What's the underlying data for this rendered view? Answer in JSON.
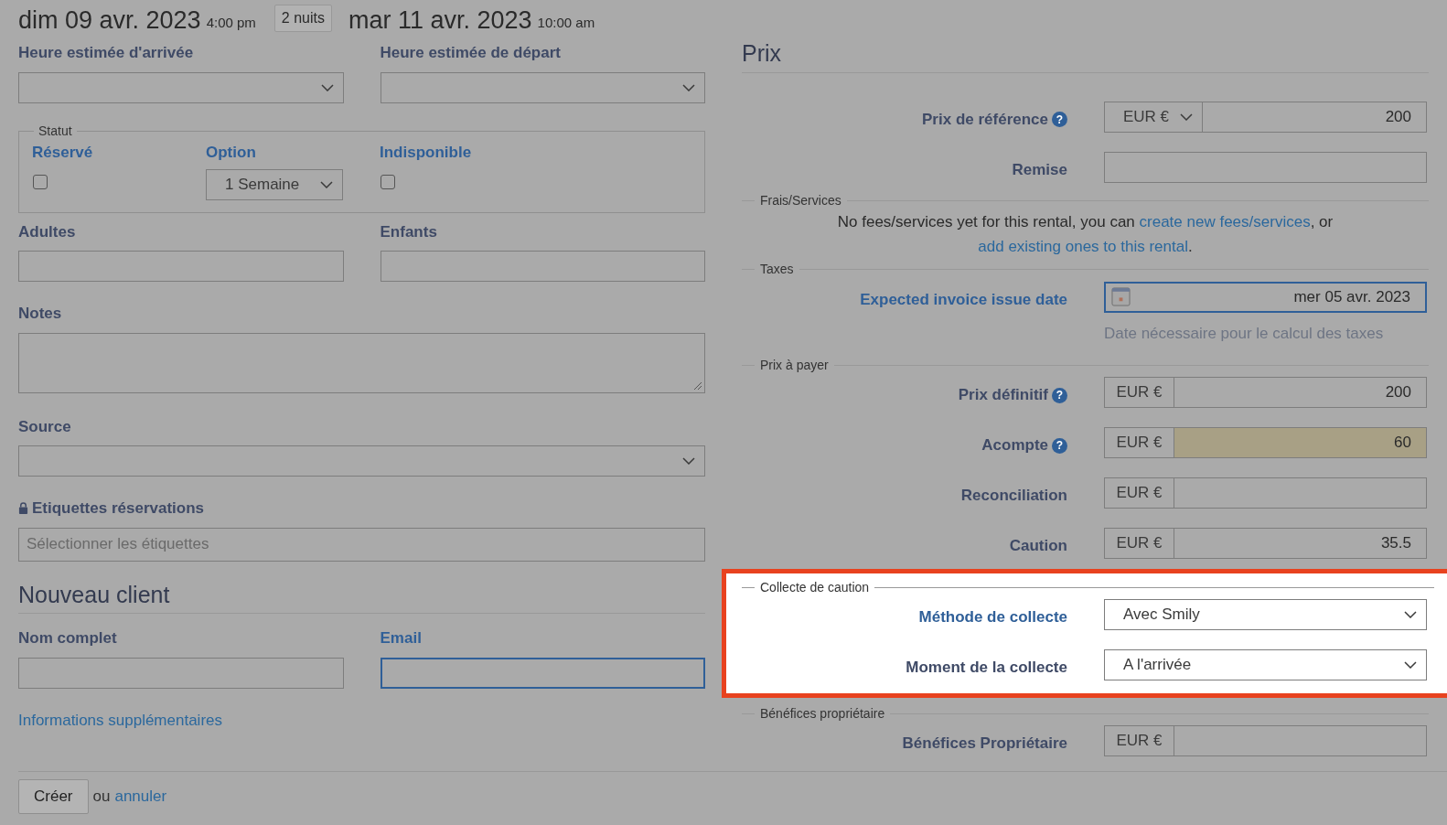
{
  "header": {
    "arrival_date": "dim 09 avr. 2023",
    "arrival_time": "4:00 pm",
    "nights": "2 nuits",
    "departure_date": "mar 11 avr. 2023",
    "departure_time": "10:00 am"
  },
  "times": [
    {
      "label": "Heure estimée d'arrivée"
    },
    {
      "label": "Heure estimée de départ"
    }
  ],
  "status": {
    "legend": "Statut",
    "items": [
      {
        "kind": "checkbox",
        "label": "Réservé",
        "checked": false
      },
      {
        "kind": "select",
        "label": "Option",
        "value": "1 Semaine"
      },
      {
        "kind": "checkbox",
        "label": "Indisponible",
        "checked": false
      }
    ]
  },
  "guests": [
    {
      "label": "Adultes"
    },
    {
      "label": "Enfants"
    }
  ],
  "notes": {
    "label": "Notes"
  },
  "source": {
    "label": "Source"
  },
  "tags": {
    "label": "Etiquettes réservations",
    "placeholder": "Sélectionner les étiquettes"
  },
  "new_client": {
    "title": "Nouveau client",
    "fields": [
      {
        "label": "Nom complet",
        "focused": false
      },
      {
        "label": "Email",
        "focused": true
      }
    ],
    "more_link": "Informations supplémentaires"
  },
  "footer": {
    "button": "Créer",
    "or": "ou",
    "cancel_link": "annuler"
  },
  "prices": {
    "title": "Prix",
    "sections": [
      {
        "rows": [
          {
            "kind": "money",
            "label": "Prix de référence",
            "help": "?",
            "currency": "EUR €",
            "currency_select": true,
            "value": "200"
          },
          {
            "kind": "text",
            "label": "Remise"
          }
        ]
      },
      {
        "legend": "Frais/Services",
        "note": [
          {
            "kind": "text",
            "text": "No fees/services yet for this rental, you can "
          },
          {
            "kind": "link",
            "text": "create new fees/services"
          },
          {
            "kind": "text",
            "text": ", or "
          },
          {
            "kind": "link",
            "text": "add existing ones to this rental"
          },
          {
            "kind": "text",
            "text": "."
          }
        ]
      },
      {
        "legend": "Taxes",
        "rows": [
          {
            "kind": "date",
            "label": "Expected invoice issue date",
            "accent": true,
            "focused": true,
            "value": "mer 05 avr. 2023",
            "hint": "Date nécessaire pour le calcul des taxes"
          }
        ]
      },
      {
        "legend": "Prix à payer",
        "rows": [
          {
            "kind": "money",
            "label": "Prix définitif",
            "help": "?",
            "currency": "EUR €",
            "value": "200"
          },
          {
            "kind": "money",
            "label": "Acompte",
            "help": "?",
            "currency": "EUR €",
            "value": "60",
            "shaded": true
          },
          {
            "kind": "money",
            "label": "Reconciliation",
            "currency": "EUR €"
          },
          {
            "kind": "money",
            "label": "Caution",
            "currency": "EUR €",
            "value": "35.5"
          }
        ]
      },
      {
        "legend": "Collecte de caution",
        "spotlight": true,
        "rows": [
          {
            "kind": "select",
            "label": "Méthode de collecte",
            "accent": true,
            "value": "Avec Smily"
          },
          {
            "kind": "select",
            "label": "Moment de la collecte",
            "value": "A l'arrivée"
          }
        ]
      },
      {
        "legend": "Bénéfices propriétaire",
        "rows": [
          {
            "kind": "money",
            "label": "Bénéfices Propriétaire",
            "currency": "EUR €"
          }
        ]
      }
    ]
  }
}
